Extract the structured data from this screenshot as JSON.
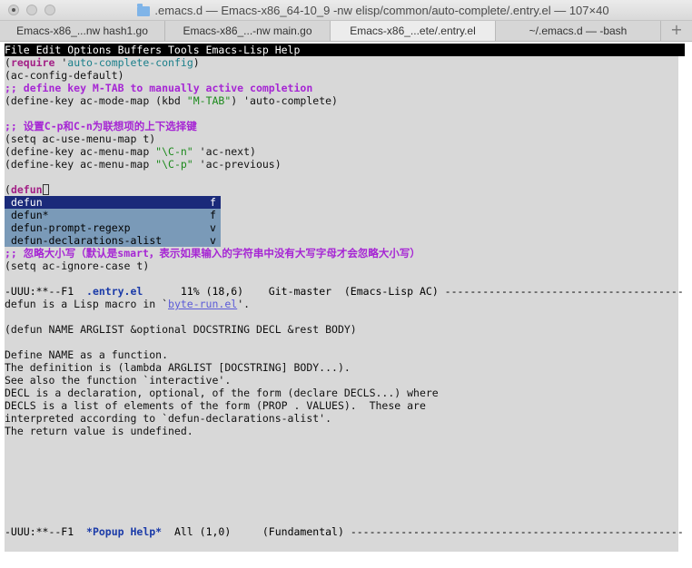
{
  "window": {
    "title": ".emacs.d — Emacs-x86_64-10_9 -nw elisp/common/auto-complete/.entry.el — 107×40"
  },
  "tabs": [
    {
      "label": "Emacs-x86_...nw hash1.go",
      "active": false
    },
    {
      "label": "Emacs-x86_...-nw main.go",
      "active": false
    },
    {
      "label": "Emacs-x86_...ete/.entry.el",
      "active": true
    },
    {
      "label": "~/.emacs.d — -bash",
      "active": false
    }
  ],
  "tab_add_label": "+",
  "menubar": "File Edit Options Buffers Tools Emacs-Lisp Help",
  "code": {
    "l1_open": "(",
    "l1_kw": "require",
    "l1_q": " '",
    "l1_const": "auto-complete-config",
    "l1_close": ")",
    "l2": "(ac-config-default)",
    "l3": ";; define key M-TAB to manually active completion",
    "l4_a": "(define-key ac-mode-map (kbd ",
    "l4_str": "\"M-TAB\"",
    "l4_b": ") 'auto-complete)",
    "l6": ";; 设置C-p和C-n为联想项的上下选择键",
    "l7": "(setq ac-use-menu-map t)",
    "l8_a": "(define-key ac-menu-map ",
    "l8_str": "\"\\C-n\"",
    "l8_b": " 'ac-next)",
    "l9_a": "(define-key ac-menu-map ",
    "l9_str": "\"\\C-p\"",
    "l9_b": " 'ac-previous)",
    "l11_open": "(",
    "l11_kw": "defun",
    "l16": ";; 忽略大小写（默认是smart，表示如果输入的字符串中没有大写字母才会忽略大小写）",
    "l17": "(setq ac-ignore-case t)"
  },
  "completion_popup": [
    {
      "label": "defun",
      "kind": "f",
      "selected": true
    },
    {
      "label": "defun*",
      "kind": "f",
      "selected": false
    },
    {
      "label": "defun-prompt-regexp",
      "kind": "v",
      "selected": false
    },
    {
      "label": "defun-declarations-alist",
      "kind": "v",
      "selected": false
    }
  ],
  "modeline_top": {
    "prefix": "-UUU:**--F1  ",
    "buffer": ".entry.el",
    "rest": "      11% (18,6)    Git-master  (Emacs-Lisp AC) -----------------------------------------------------------"
  },
  "help": {
    "l1_a": "defun is a Lisp macro in `",
    "l1_link": "byte-run.el",
    "l1_b": "'.",
    "l3": "(defun NAME ARGLIST &optional DOCSTRING DECL &rest BODY)",
    "l5": "Define NAME as a function.",
    "l6": "The definition is (lambda ARGLIST [DOCSTRING] BODY...).",
    "l7": "See also the function `interactive'.",
    "l8": "DECL is a declaration, optional, of the form (declare DECLS...) where",
    "l9": "DECLS is a list of elements of the form (PROP . VALUES).  These are",
    "l10": "interpreted according to `defun-declarations-alist'.",
    "l11": "The return value is undefined."
  },
  "modeline_bottom": {
    "prefix": "-UUU:**--F1  ",
    "buffer": "*Popup Help*",
    "rest": "  All (1,0)     (Fundamental) -----------------------------------------------------------------"
  },
  "colors": {
    "keyword": "#a32086",
    "constant": "#1a7f8a",
    "comment": "#a626d4",
    "string": "#1c8a1c",
    "popup_bg": "#7a9ab8",
    "popup_selected": "#1a2a7a",
    "buffer_name": "#1a3aa8"
  }
}
